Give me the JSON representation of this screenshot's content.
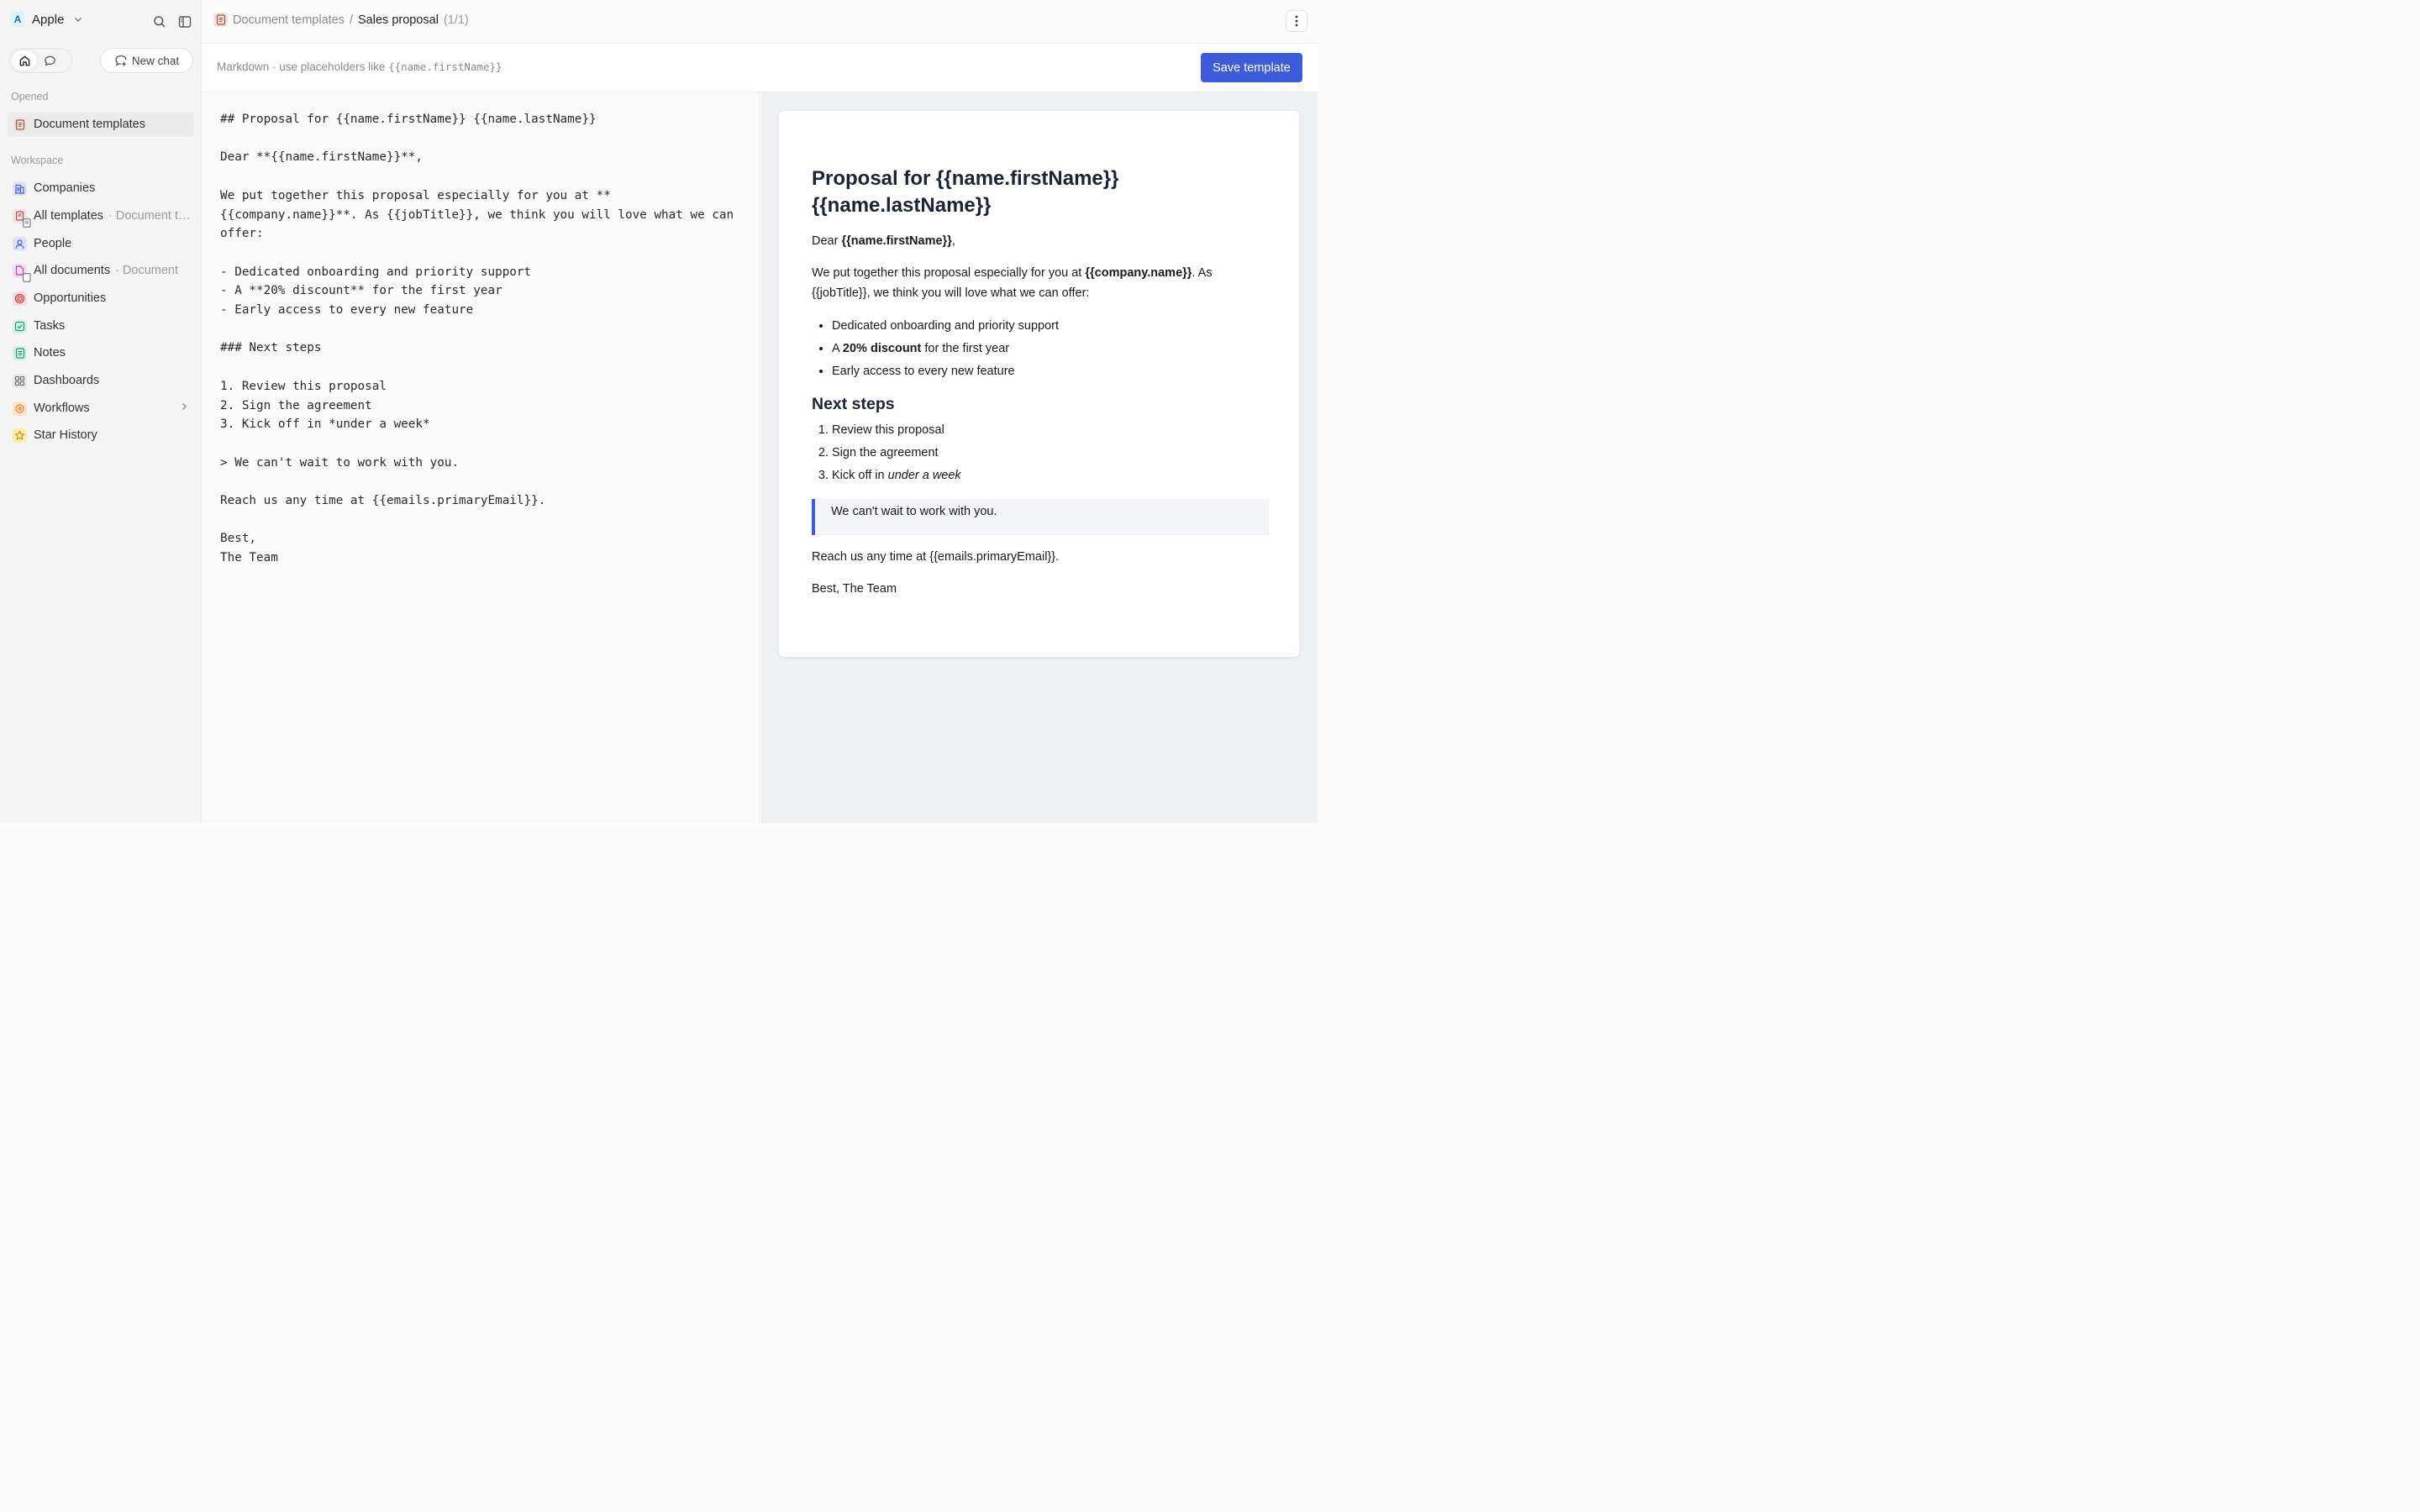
{
  "workspace": {
    "badge": "A",
    "name": "Apple"
  },
  "sidebar": {
    "new_chat": "New chat",
    "opened_label": "Opened",
    "opened_item": "Document templates",
    "workspace_label": "Workspace",
    "items": [
      {
        "label": "Companies",
        "sub": ""
      },
      {
        "label": "All templates",
        "sub": "· Document t…"
      },
      {
        "label": "People",
        "sub": ""
      },
      {
        "label": "All documents",
        "sub": "· Document"
      },
      {
        "label": "Opportunities",
        "sub": ""
      },
      {
        "label": "Tasks",
        "sub": ""
      },
      {
        "label": "Notes",
        "sub": ""
      },
      {
        "label": "Dashboards",
        "sub": ""
      },
      {
        "label": "Workflows",
        "sub": ""
      },
      {
        "label": "Star History",
        "sub": ""
      }
    ]
  },
  "breadcrumb": {
    "parent": "Document templates",
    "sep": "/",
    "title": "Sales proposal",
    "count": "(1/1)"
  },
  "hint": {
    "text": "Markdown · use placeholders like",
    "code": "{{name.firstName}}"
  },
  "save_button": "Save template",
  "editor": {
    "source": "## Proposal for {{name.firstName}} {{name.lastName}}\n\nDear **{{name.firstName}}**,\n\nWe put together this proposal especially for you at **{{company.name}}**. As {{jobTitle}}, we think you will love what we can offer:\n\n- Dedicated onboarding and priority support\n- A **20% discount** for the first year\n- Early access to every new feature\n\n### Next steps\n\n1. Review this proposal\n2. Sign the agreement\n3. Kick off in *under a week*\n\n> We can't wait to work with you.\n\nReach us any time at {{emails.primaryEmail}}.\n\nBest,\nThe Team"
  },
  "preview": {
    "title": "Proposal for {{name.firstName}} {{name.lastName}}",
    "dear_prefix": "Dear ",
    "dear_name": "{{name.firstName}}",
    "dear_suffix": ",",
    "intro_a": "We put together this proposal especially for you at ",
    "intro_company": "{{company.name}}",
    "intro_b": ". As {{jobTitle}}, we think you will love what we can offer:",
    "b1": "Dedicated onboarding and priority support",
    "b2_a": "A ",
    "b2_bold": "20% discount",
    "b2_b": " for the first year",
    "b3": "Early access to every new feature",
    "steps_heading": "Next steps",
    "s1": "Review this proposal",
    "s2": "Sign the agreement",
    "s3_a": "Kick off in ",
    "s3_em": "under a week",
    "quote": "We can't wait to work with you.",
    "reach": "Reach us any time at {{emails.primaryEmail}}.",
    "signoff": "Best, The Team"
  },
  "colors": {
    "accent": "#3d5bdb"
  }
}
